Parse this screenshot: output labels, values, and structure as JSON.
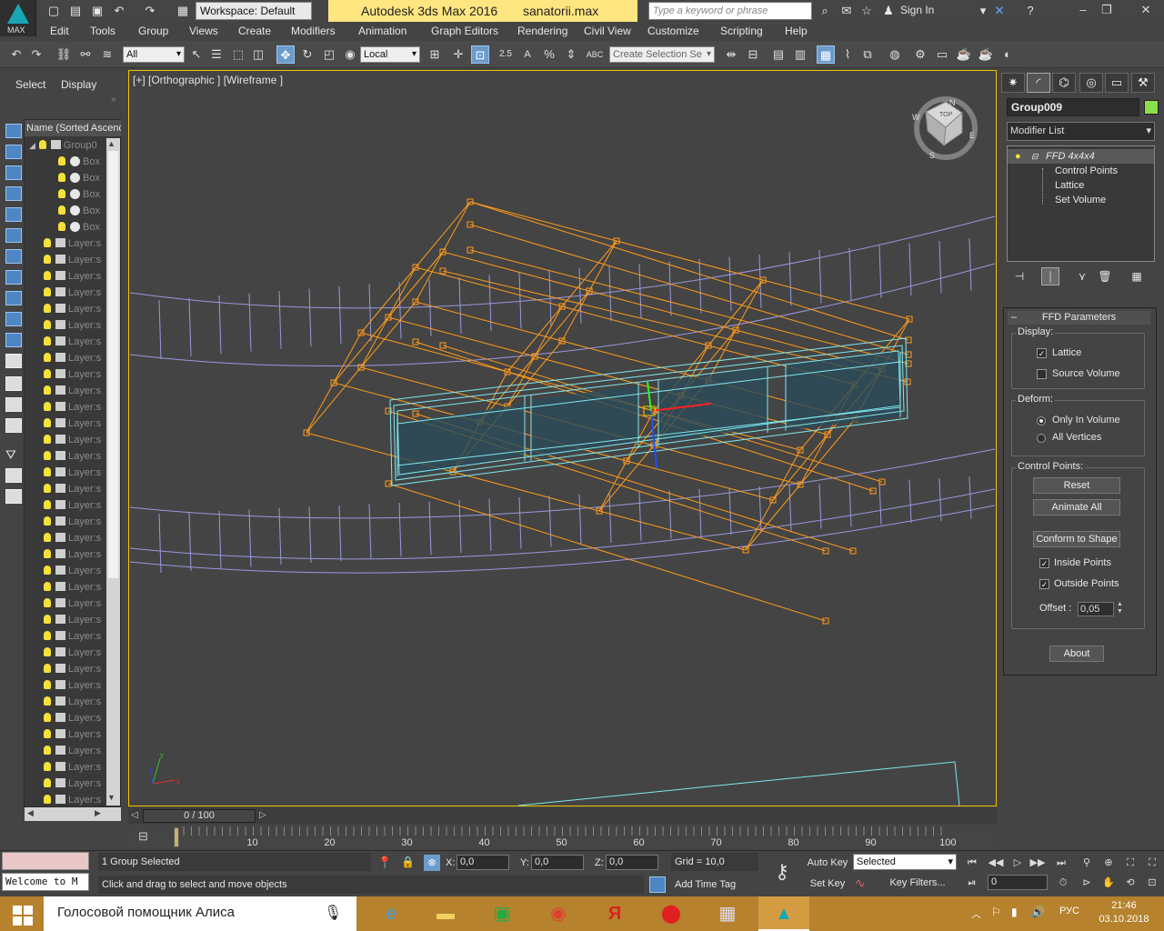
{
  "title_bar": {
    "workspace": "Workspace: Default",
    "app_title": "Autodesk 3ds Max 2016",
    "file_name": "sanatorii.max",
    "search_placeholder": "Type a keyword or phrase",
    "sign_in": "Sign In",
    "logo_label": "MAX"
  },
  "menu": [
    "Edit",
    "Tools",
    "Group",
    "Views",
    "Create",
    "Modifiers",
    "Animation",
    "Graph Editors",
    "Rendering",
    "Civil View",
    "Customize",
    "Scripting",
    "Help"
  ],
  "toolbar": {
    "selection_filter": "All",
    "ref_coord": "Local",
    "selection_set_placeholder": "Create Selection Se",
    "snap_2_5": "2.5",
    "angle_snap": "A",
    "percent_snap": "%",
    "abc_label": "ABC"
  },
  "explorer": {
    "tab_select": "Select",
    "tab_display": "Display",
    "column_header": "Name (Sorted Ascend",
    "group_row": "Group0",
    "box_rows": [
      "Box",
      "Box",
      "Box",
      "Box",
      "Box"
    ],
    "layer_label": "Layer:s",
    "layer_count": 35
  },
  "viewport": {
    "label": "[+] [Orthographic ] [Wireframe ]",
    "viewcube_face": "TOP",
    "compass": {
      "n": "N",
      "e": "E",
      "s": "S",
      "w": "W"
    }
  },
  "command_panel": {
    "object_name": "Group009",
    "object_color": "#8ae04a",
    "modifier_list": "Modifier List",
    "stack": {
      "modifier": "FFD 4x4x4",
      "subobjects": [
        "Control Points",
        "Lattice",
        "Set Volume"
      ]
    },
    "rollout_title": "FFD Parameters",
    "display_label": "Display:",
    "lattice": {
      "label": "Lattice",
      "checked": true
    },
    "source_volume": {
      "label": "Source Volume",
      "checked": false
    },
    "deform_label": "Deform:",
    "deform_options": [
      {
        "label": "Only In Volume",
        "selected": true
      },
      {
        "label": "All Vertices",
        "selected": false
      }
    ],
    "control_points_label": "Control Points:",
    "reset": "Reset",
    "animate_all": "Animate All",
    "conform_to_shape": "Conform to Shape",
    "inside_points": {
      "label": "Inside Points",
      "checked": true
    },
    "outside_points": {
      "label": "Outside Points",
      "checked": true
    },
    "offset_label": "Offset :",
    "offset_value": "0,05",
    "about": "About"
  },
  "timeline": {
    "slider_label": "0 / 100",
    "ticks": [
      "10",
      "20",
      "30",
      "40",
      "50",
      "60",
      "70",
      "80",
      "90",
      "100"
    ]
  },
  "status": {
    "selection": "1 Group Selected",
    "prompt": "Click and drag to select and move objects",
    "maxscript": "Welcome to M",
    "x_label": "X:",
    "x_value": "0,0",
    "y_label": "Y:",
    "y_value": "0,0",
    "z_label": "Z:",
    "z_value": "0,0",
    "grid": "Grid = 10,0",
    "add_time_tag": "Add Time Tag",
    "auto_key": "Auto Key",
    "set_key": "Set Key",
    "key_mode": "Selected",
    "key_filters": "Key Filters...",
    "current_frame": "0"
  },
  "taskbar": {
    "assistant": "Голосовой помощник Алиса",
    "language": "РУС",
    "time": "21:46",
    "date": "03.10.2018",
    "yandex_letter": "Я"
  },
  "colors": {
    "lattice": "#ff9b1a",
    "selection": "#7fe8f2",
    "scene_wire": "#9898e0",
    "viewport_border": "#f2c200",
    "title_highlight": "#ffe680"
  }
}
